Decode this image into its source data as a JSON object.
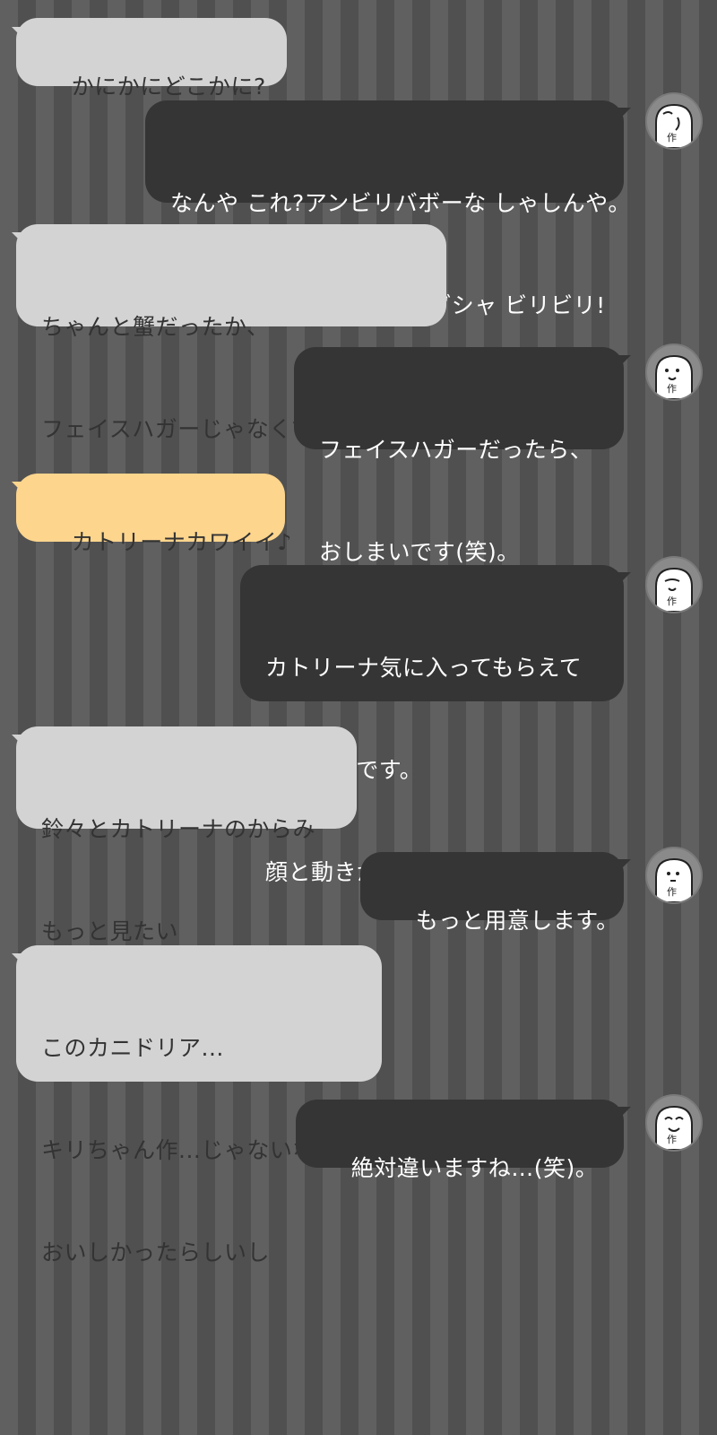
{
  "messages": [
    {
      "side": "in",
      "lines": [
        "かにかにどこかに?"
      ]
    },
    {
      "side": "out",
      "avatar": "author-avatar-icon",
      "lines": [
        "なんや これ?アンビリバボーな しゃしんや。",
        "こんなん こうしてやる、グシャ ビリビリ!"
      ]
    },
    {
      "side": "in",
      "lines": [
        "ちゃんと蟹だったか、",
        "フェイスハガーじゃなくてよかった"
      ]
    },
    {
      "side": "out",
      "avatar": "author-avatar-icon",
      "lines": [
        "フェイスハガーだったら、",
        "おしまいです(笑)。"
      ]
    },
    {
      "side": "in",
      "highlight": "#fdd58d",
      "lines": [
        "カトリーナカワイイ♪"
      ]
    },
    {
      "side": "out",
      "avatar": "author-avatar-icon",
      "lines": [
        "カトリーナ気に入ってもらえて",
        "うれしいです。",
        "顔と動きがたのしい。"
      ]
    },
    {
      "side": "in",
      "lines": [
        "鈴々とカトリーナのからみ",
        "もっと見たい"
      ]
    },
    {
      "side": "out",
      "avatar": "author-avatar-icon",
      "lines": [
        "もっと用意します。"
      ]
    },
    {
      "side": "in",
      "lines": [
        "このカニドリア...",
        "キリちゃん作...じゃないな...",
        "おいしかったらしいし"
      ]
    },
    {
      "side": "out",
      "avatar": "author-avatar-icon",
      "lines": [
        "絶対違いますね…(笑)。"
      ]
    }
  ],
  "avatar_label": "作",
  "colors": {
    "incoming_bubble": "#d3d3d3",
    "incoming_highlight": "#fdd58d",
    "outgoing_bubble": "#353535",
    "stripe_light": "#606060",
    "stripe_dark": "#505050"
  }
}
